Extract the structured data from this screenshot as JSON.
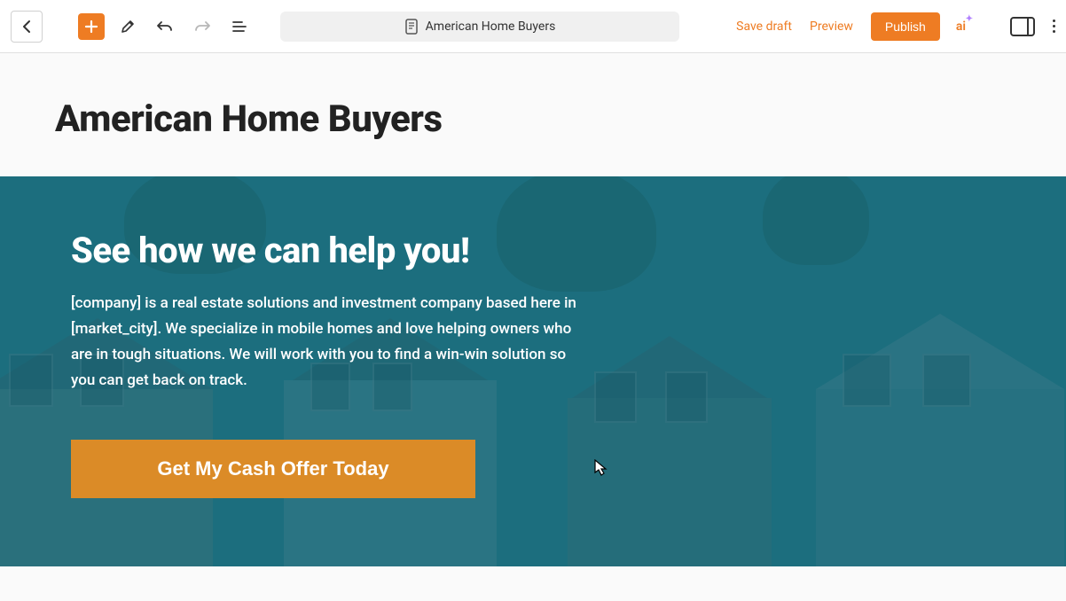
{
  "toolbar": {
    "title": "American Home Buyers",
    "save_draft": "Save draft",
    "preview": "Preview",
    "publish": "Publish",
    "ai_label": "ai"
  },
  "page": {
    "title": "American Home Buyers"
  },
  "hero": {
    "heading": "See how we can help you!",
    "body": "[company] is a real estate solutions and investment company based here in [market_city]. We specialize in mobile homes and love helping owners who are in tough situations. We will work with you to find a win-win solution so you can get back on track.",
    "cta": "Get My Cash Offer Today"
  }
}
